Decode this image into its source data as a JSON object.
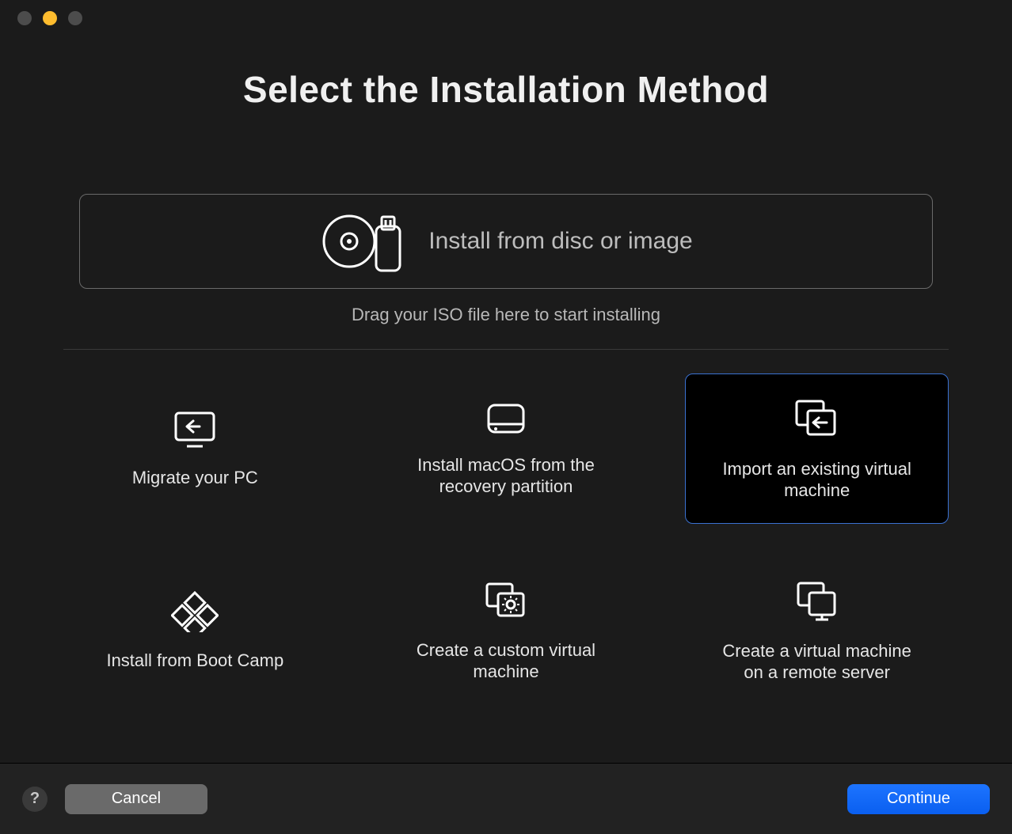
{
  "title": "Select the Installation Method",
  "dropzone": {
    "label": "Install from disc or image",
    "hint": "Drag your ISO file here to start installing"
  },
  "options": [
    {
      "id": "migrate-pc",
      "label": "Migrate your PC"
    },
    {
      "id": "install-macos",
      "label": "Install macOS from the recovery partition"
    },
    {
      "id": "import-vm",
      "label": "Import an existing virtual machine",
      "selected": true
    },
    {
      "id": "install-bootcamp",
      "label": "Install from Boot Camp"
    },
    {
      "id": "create-custom-vm",
      "label": "Create a custom virtual machine"
    },
    {
      "id": "create-remote-vm",
      "label": "Create a virtual machine on a remote server"
    }
  ],
  "toolbar": {
    "help": "?",
    "cancel": "Cancel",
    "continue": "Continue"
  }
}
